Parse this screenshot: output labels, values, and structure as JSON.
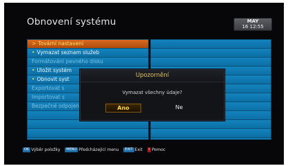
{
  "screen": {
    "title": "Obnovení systému",
    "clock": {
      "month": "MAY",
      "day": "16",
      "time": "12:55"
    }
  },
  "menu": {
    "items": [
      {
        "label": "Tovární nastavení",
        "selected": true,
        "dimmed": false
      },
      {
        "label": "Vymazat seznam služeb",
        "selected": false,
        "dimmed": false
      },
      {
        "label": "Formátování pevného disku",
        "selected": false,
        "dimmed": true
      },
      {
        "label": "Uložit systém",
        "selected": false,
        "dimmed": false
      },
      {
        "label": "Obnovit syst",
        "selected": false,
        "dimmed": false
      },
      {
        "label": "Exportovat s",
        "selected": false,
        "dimmed": true
      },
      {
        "label": "Importovat s",
        "selected": false,
        "dimmed": true
      },
      {
        "label": "Bezpečné odpojení disku",
        "selected": false,
        "dimmed": true
      },
      {
        "label": "",
        "selected": false,
        "dimmed": false
      },
      {
        "label": "",
        "selected": false,
        "dimmed": false
      },
      {
        "label": "",
        "selected": false,
        "dimmed": false
      }
    ]
  },
  "dialog": {
    "title": "Upozornění",
    "message": "Vymazat všechny údaje?",
    "yes_label": "Ano",
    "no_label": "Ne"
  },
  "footer": {
    "items": [
      {
        "key": "OK",
        "label": "Výběr položky"
      },
      {
        "key": "MENU",
        "label": "Předcházející menu"
      },
      {
        "key": "EXIT",
        "label": "Exit"
      },
      {
        "key": "i",
        "label": "Pomoc"
      }
    ]
  },
  "colors": {
    "background": "#07070a",
    "panel": "#0e78b0",
    "selected_row": "#c85a16",
    "dialog": "#121418",
    "dialog_title_text": "#e2c060",
    "highlight_text": "#ffd84a"
  }
}
